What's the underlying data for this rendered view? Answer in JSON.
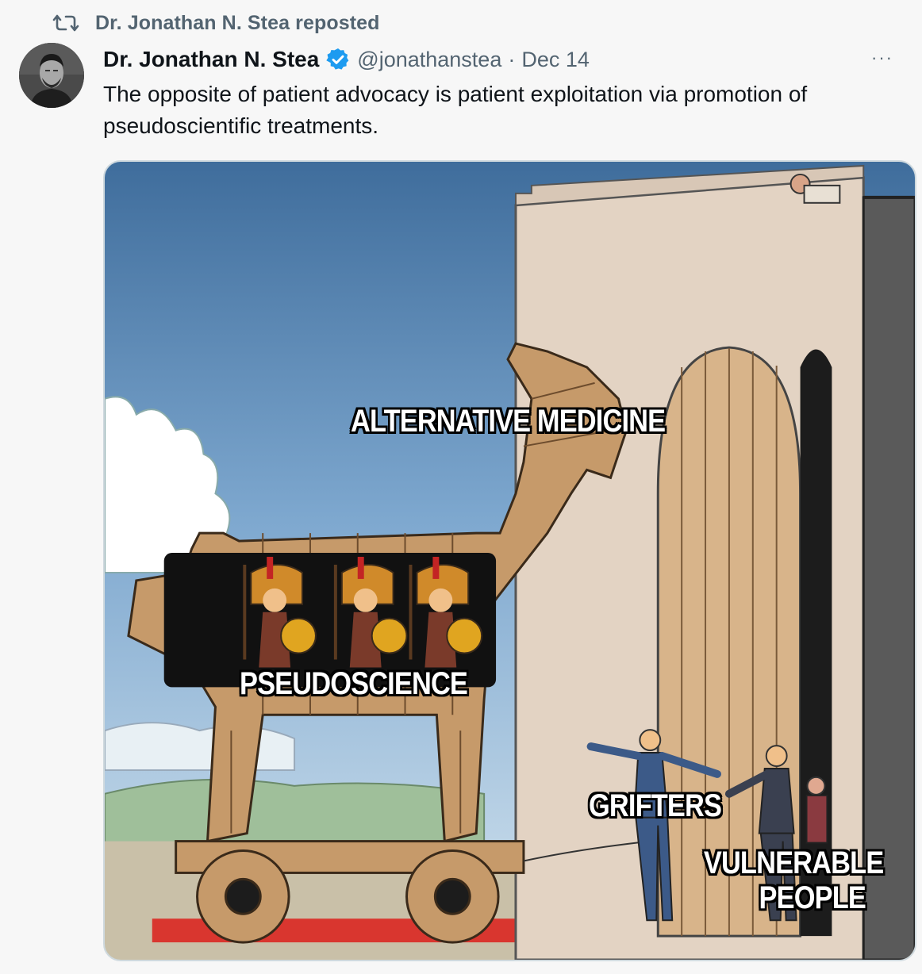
{
  "repost": {
    "icon": "repost-icon",
    "text": "Dr. Jonathan N. Stea reposted"
  },
  "tweet": {
    "author_name": "Dr. Jonathan N. Stea",
    "verified_icon": "verified-badge-icon",
    "handle": "@jonathanstea",
    "separator": "·",
    "date": "Dec 14",
    "more_icon": "more-icon",
    "more_glyph": "···",
    "text": "The opposite of patient advocacy is patient exploitation via promotion of pseudoscientific treatments."
  },
  "meme": {
    "labels": {
      "horse": "ALTERNATIVE MEDICINE",
      "soldiers": "PSEUDOSCIENCE",
      "men": "GRIFTERS",
      "people_line1": "VULNERABLE",
      "people_line2": "PEOPLE"
    }
  },
  "colors": {
    "verified": "#1d9bf0",
    "secondary_text": "#536471",
    "primary_text": "#0f1419",
    "background": "#f7f7f7"
  }
}
